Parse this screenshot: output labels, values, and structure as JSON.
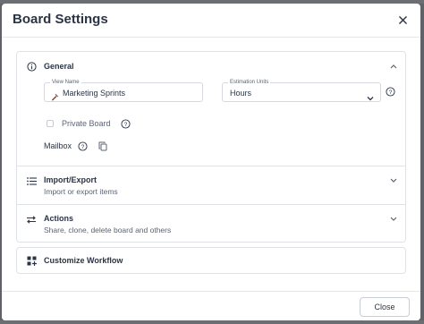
{
  "modal": {
    "title": "Board Settings",
    "close_icon": "close-icon"
  },
  "general": {
    "title": "General",
    "icon": "info-circle-icon",
    "expanded": true,
    "view_name": {
      "label": "View Name",
      "value": "Marketing Sprints",
      "icon": "hammer-icon"
    },
    "estimation_units": {
      "label": "Estimation Units",
      "value": "Hours"
    },
    "private_board": {
      "label": "Private Board",
      "checked": false
    },
    "mailbox": {
      "label": "Mailbox"
    }
  },
  "import_export": {
    "title": "Import/Export",
    "subtitle": "Import or export items",
    "icon": "list-icon"
  },
  "actions": {
    "title": "Actions",
    "subtitle": "Share, clone, delete board and others",
    "icon": "swap-arrows-icon"
  },
  "workflow": {
    "title": "Customize Workflow",
    "icon": "grid-plus-icon"
  },
  "footer": {
    "close_label": "Close"
  },
  "colors": {
    "text": "#2b3445",
    "muted": "#5b6473",
    "border": "#dfe3e8",
    "backdrop": "#5f6368"
  }
}
